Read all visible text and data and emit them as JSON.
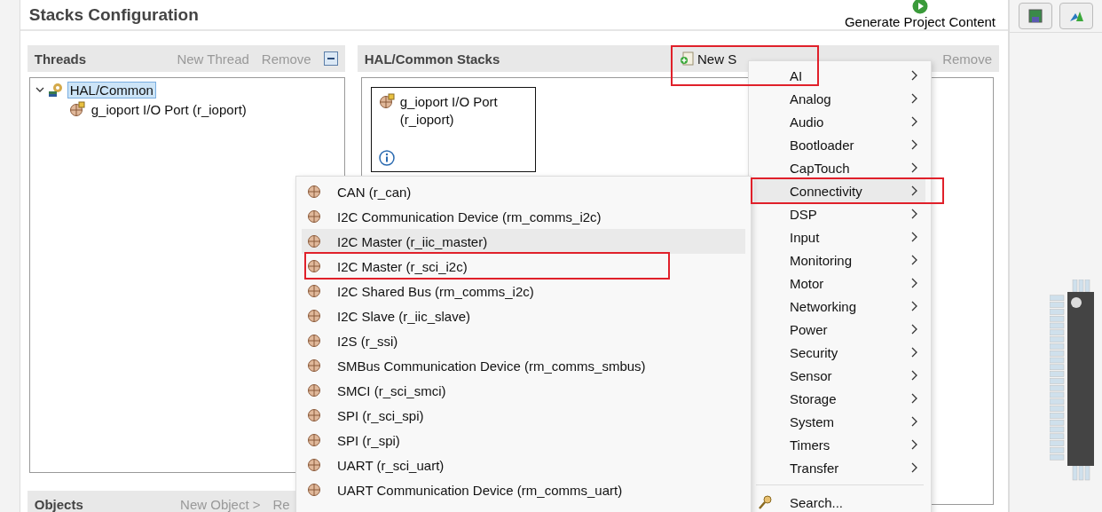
{
  "header": {
    "title": "Stacks Configuration",
    "generate_button": "Generate Project Content"
  },
  "threads": {
    "title": "Threads",
    "new_thread": "New Thread",
    "remove": "Remove",
    "tree": [
      {
        "label": "HAL/Common",
        "selected": true,
        "expanded": true,
        "children": [
          {
            "label": "g_ioport I/O Port (r_ioport)",
            "selected": false
          }
        ]
      }
    ]
  },
  "stacks": {
    "title": "HAL/Common Stacks",
    "new_stack": {
      "label": "New S",
      "highlighted": true
    },
    "remove": "Remove",
    "modules": [
      {
        "name": "g_ioport I/O Port (r_ioport)"
      }
    ]
  },
  "objects": {
    "title": "Objects",
    "new_object": "New Object >",
    "remove": "Re"
  },
  "category_menu": {
    "items": [
      {
        "label": "AI",
        "selected": false,
        "highlighted": false,
        "submenu": true
      },
      {
        "label": "Analog",
        "selected": false,
        "highlighted": false,
        "submenu": true
      },
      {
        "label": "Audio",
        "selected": false,
        "highlighted": false,
        "submenu": true
      },
      {
        "label": "Bootloader",
        "selected": false,
        "highlighted": false,
        "submenu": true
      },
      {
        "label": "CapTouch",
        "selected": false,
        "highlighted": false,
        "submenu": true
      },
      {
        "label": "Connectivity",
        "selected": true,
        "highlighted": true,
        "submenu": true
      },
      {
        "label": "DSP",
        "selected": false,
        "highlighted": false,
        "submenu": true
      },
      {
        "label": "Input",
        "selected": false,
        "highlighted": false,
        "submenu": true
      },
      {
        "label": "Monitoring",
        "selected": false,
        "highlighted": false,
        "submenu": true
      },
      {
        "label": "Motor",
        "selected": false,
        "highlighted": false,
        "submenu": true
      },
      {
        "label": "Networking",
        "selected": false,
        "highlighted": false,
        "submenu": true
      },
      {
        "label": "Power",
        "selected": false,
        "highlighted": false,
        "submenu": true
      },
      {
        "label": "Security",
        "selected": false,
        "highlighted": false,
        "submenu": true
      },
      {
        "label": "Sensor",
        "selected": false,
        "highlighted": false,
        "submenu": true
      },
      {
        "label": "Storage",
        "selected": false,
        "highlighted": false,
        "submenu": true
      },
      {
        "label": "System",
        "selected": false,
        "highlighted": false,
        "submenu": true
      },
      {
        "label": "Timers",
        "selected": false,
        "highlighted": false,
        "submenu": true
      },
      {
        "label": "Transfer",
        "selected": false,
        "highlighted": false,
        "submenu": true
      }
    ],
    "search": "Search..."
  },
  "connectivity_menu": {
    "items": [
      {
        "label": "CAN (r_can)",
        "selected": false,
        "highlighted": false
      },
      {
        "label": "I2C Communication Device (rm_comms_i2c)",
        "selected": false,
        "highlighted": false
      },
      {
        "label": "I2C Master (r_iic_master)",
        "selected": true,
        "highlighted": false
      },
      {
        "label": "I2C Master (r_sci_i2c)",
        "selected": false,
        "highlighted": true
      },
      {
        "label": "I2C Shared Bus (rm_comms_i2c)",
        "selected": false,
        "highlighted": false
      },
      {
        "label": "I2C Slave (r_iic_slave)",
        "selected": false,
        "highlighted": false
      },
      {
        "label": "I2S (r_ssi)",
        "selected": false,
        "highlighted": false
      },
      {
        "label": "SMBus Communication Device (rm_comms_smbus)",
        "selected": false,
        "highlighted": false
      },
      {
        "label": "SMCI (r_sci_smci)",
        "selected": false,
        "highlighted": false
      },
      {
        "label": "SPI (r_sci_spi)",
        "selected": false,
        "highlighted": false
      },
      {
        "label": "SPI (r_spi)",
        "selected": false,
        "highlighted": false
      },
      {
        "label": "UART (r_sci_uart)",
        "selected": false,
        "highlighted": false
      },
      {
        "label": "UART Communication Device (rm_comms_uart)",
        "selected": false,
        "highlighted": false
      }
    ]
  }
}
